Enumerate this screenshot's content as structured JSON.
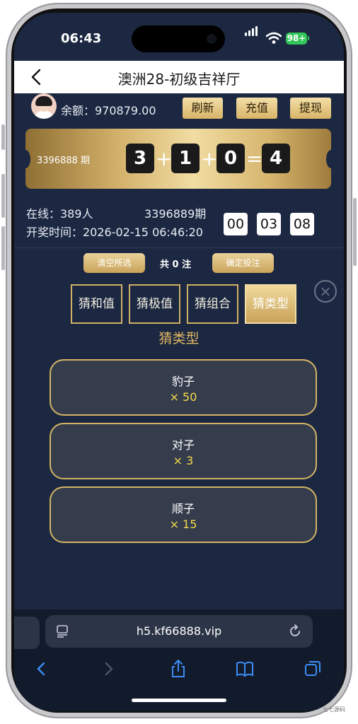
{
  "status_bar": {
    "time": "06:43",
    "battery": "98+"
  },
  "header": {
    "title": "澳洲28-初级吉祥厅"
  },
  "account": {
    "balance_label": "余额：",
    "balance_value": "970879.00"
  },
  "top_buttons": {
    "refresh": "刷新",
    "recharge": "充值",
    "withdraw": "提现"
  },
  "result": {
    "issue": "3396888 期",
    "digits": [
      "3",
      "1",
      "0",
      "4"
    ],
    "operators": [
      "+",
      "+",
      "="
    ]
  },
  "info": {
    "online": "在线：389人",
    "next_issue": "3396889期",
    "draw_time": "开奖时间：2026-02-15 06:46:20",
    "countdown": [
      "00",
      "03",
      "08"
    ]
  },
  "actions": {
    "clear": "清空所选",
    "count": "共 0 注",
    "confirm": "确定投注"
  },
  "tabs": [
    {
      "label": "猜和值",
      "active": false
    },
    {
      "label": "猜极值",
      "active": false
    },
    {
      "label": "猜组合",
      "active": false
    },
    {
      "label": "猜类型",
      "active": true
    }
  ],
  "section": {
    "title": "猜类型"
  },
  "options": [
    {
      "name": "豹子",
      "odds": "× 50"
    },
    {
      "name": "对子",
      "odds": "× 3"
    },
    {
      "name": "顺子",
      "odds": "× 15"
    }
  ],
  "browser": {
    "url": "h5.kf66888.vip"
  },
  "watermark": "七七源码",
  "colors": {
    "background": "#1c2842",
    "gold": "#d3b464",
    "odds": "#f6d94a"
  }
}
